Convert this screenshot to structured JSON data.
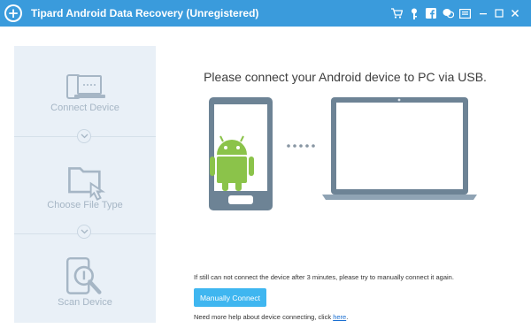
{
  "window": {
    "title": "Tipard Android Data Recovery (Unregistered)",
    "logo_icon": "plus-icon",
    "accent_color": "#3a9bdc",
    "buttons": [
      {
        "name": "cart-icon"
      },
      {
        "name": "key-icon"
      },
      {
        "name": "facebook-icon"
      },
      {
        "name": "chat-icon"
      },
      {
        "name": "menu-icon"
      },
      {
        "name": "minimize-icon"
      },
      {
        "name": "maximize-icon"
      },
      {
        "name": "close-icon"
      }
    ]
  },
  "sidebar": {
    "steps": [
      {
        "label": "Connect Device",
        "icon": "connect-device-icon"
      },
      {
        "label": "Choose File Type",
        "icon": "choose-file-type-icon"
      },
      {
        "label": "Scan Device",
        "icon": "scan-device-icon"
      }
    ]
  },
  "main": {
    "headline": "Please connect your Android device to PC via USB.",
    "hint": "If still can not connect the device after 3 minutes, please try to manually connect it again.",
    "manual_connect_label": "Manually Connect",
    "help_text": "Need more help about device connecting, click ",
    "help_link": "here",
    "help_suffix": ".",
    "button_color": "#3fb6f0"
  }
}
